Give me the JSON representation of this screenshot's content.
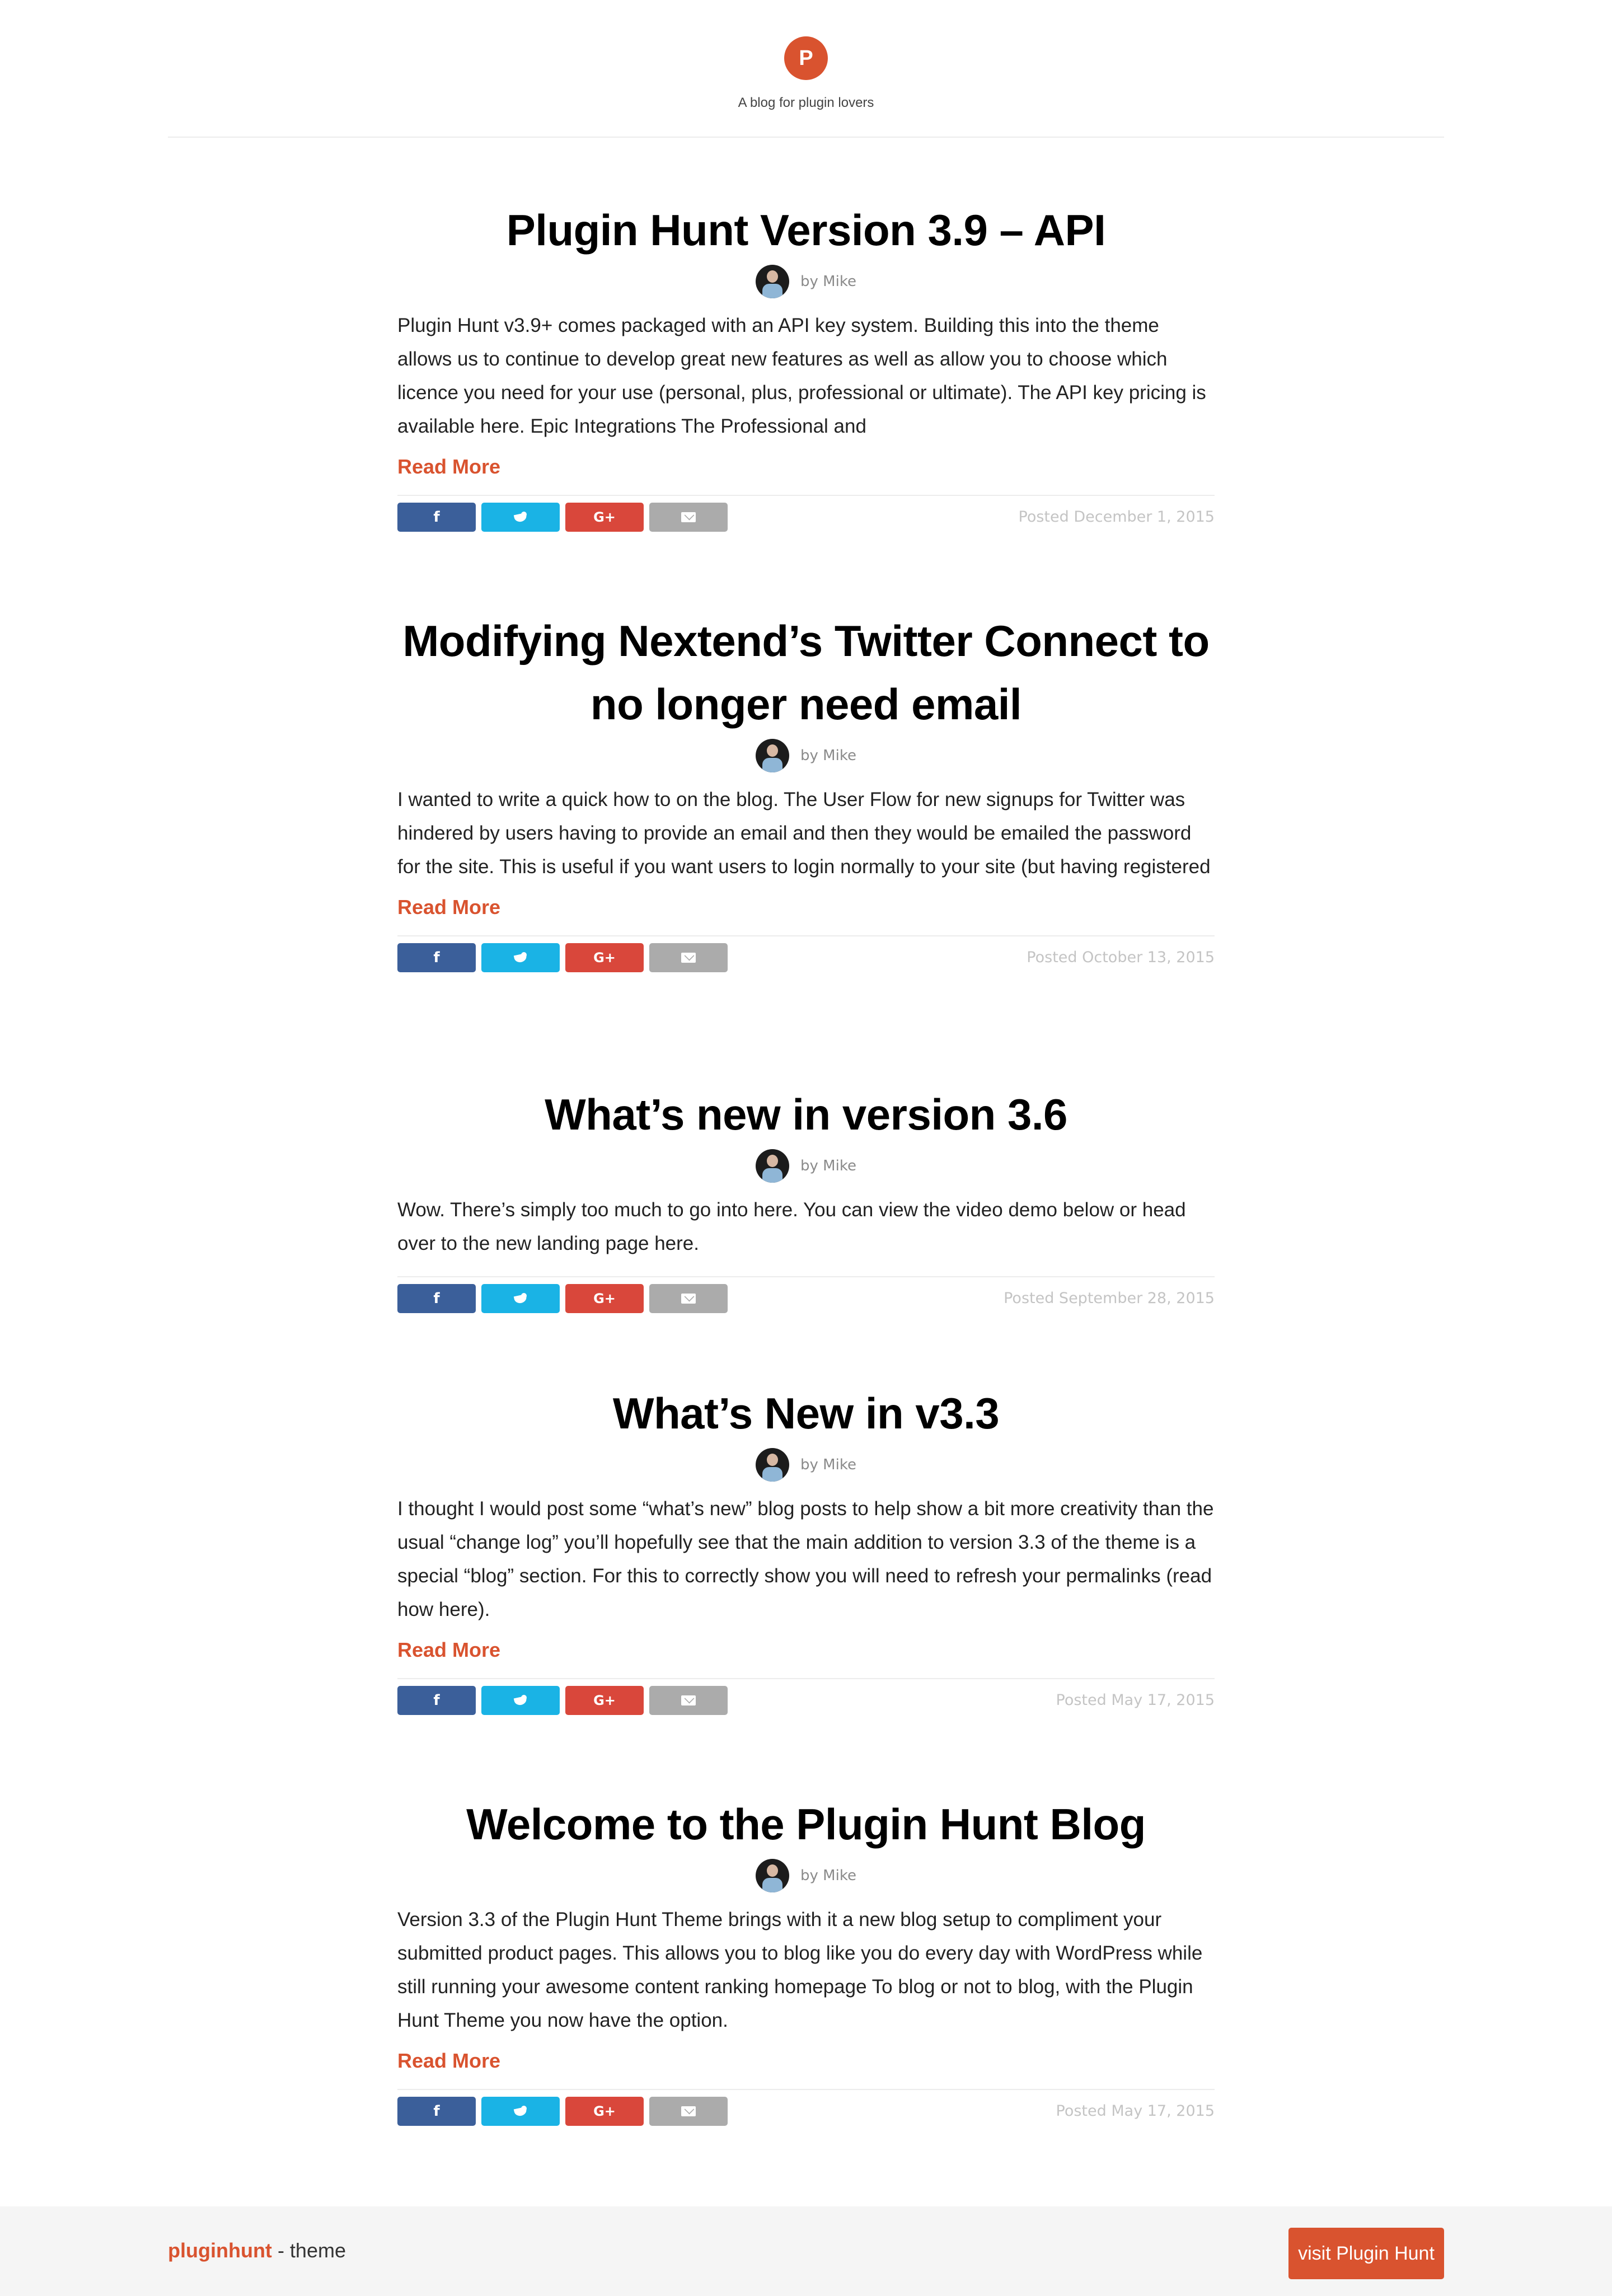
{
  "site": {
    "logo_letter": "P",
    "tagline": "A blog for plugin lovers"
  },
  "share_icons": {
    "facebook": "f",
    "twitter": "twitter-bird-icon",
    "google_plus": "G+",
    "email": "envelope-icon"
  },
  "colors": {
    "accent": "#d9532f",
    "facebook": "#3b5f9a",
    "twitter": "#1ab3e5",
    "google_plus": "#d9473b",
    "email": "#ababab"
  },
  "posts": [
    {
      "title": "Plugin Hunt Version 3.9 – API",
      "byline": "by Mike",
      "excerpt": "Plugin Hunt v3.9+ comes packaged with an API key system. Building this into the theme allows us to continue to develop great new features as well as allow you to choose which licence you need for your use (personal, plus, professional or ultimate). The API key pricing is available here. Epic Integrations The Professional and",
      "read_more": "Read More",
      "posted": "Posted December 1, 2015"
    },
    {
      "title": "Modifying Nextend’s Twitter Connect to no longer need email",
      "byline": "by Mike",
      "excerpt": "I wanted to write a quick how to on the blog. The User Flow for new signups for Twitter was hindered by users having to provide an email and then they would be emailed the password for the site. This is useful if you want users to login normally to your site (but having registered",
      "read_more": "Read More",
      "posted": "Posted October 13, 2015"
    },
    {
      "title": "What’s new in version 3.6",
      "byline": "by Mike",
      "excerpt": "Wow. There’s simply too much to go into here. You can view the video demo below or head over to the new landing page here.",
      "posted": "Posted September 28, 2015"
    },
    {
      "title": "What’s New in v3.3",
      "byline": "by Mike",
      "excerpt": "I thought I would post some “what’s new” blog posts to help show a bit more creativity than the usual “change log” you’ll hopefully see that the main addition to version 3.3 of the theme is a special “blog” section. For this to correctly show you will need to refresh your permalinks (read how here).",
      "read_more": "Read More",
      "posted": "Posted May 17, 2015"
    },
    {
      "title": "Welcome to the Plugin Hunt Blog",
      "byline": "by Mike",
      "excerpt": "Version 3.3 of the Plugin Hunt Theme brings with it a new blog setup to compliment your submitted product pages. This allows you to blog like you do every day with WordPress while still running your awesome content ranking homepage To blog or not to blog, with the Plugin Hunt Theme you now have the option.",
      "read_more": "Read More",
      "posted": "Posted May 17, 2015"
    }
  ],
  "footer": {
    "brand_name": "pluginhunt",
    "brand_suffix": " - theme",
    "visit_button": "visit Plugin Hunt"
  }
}
